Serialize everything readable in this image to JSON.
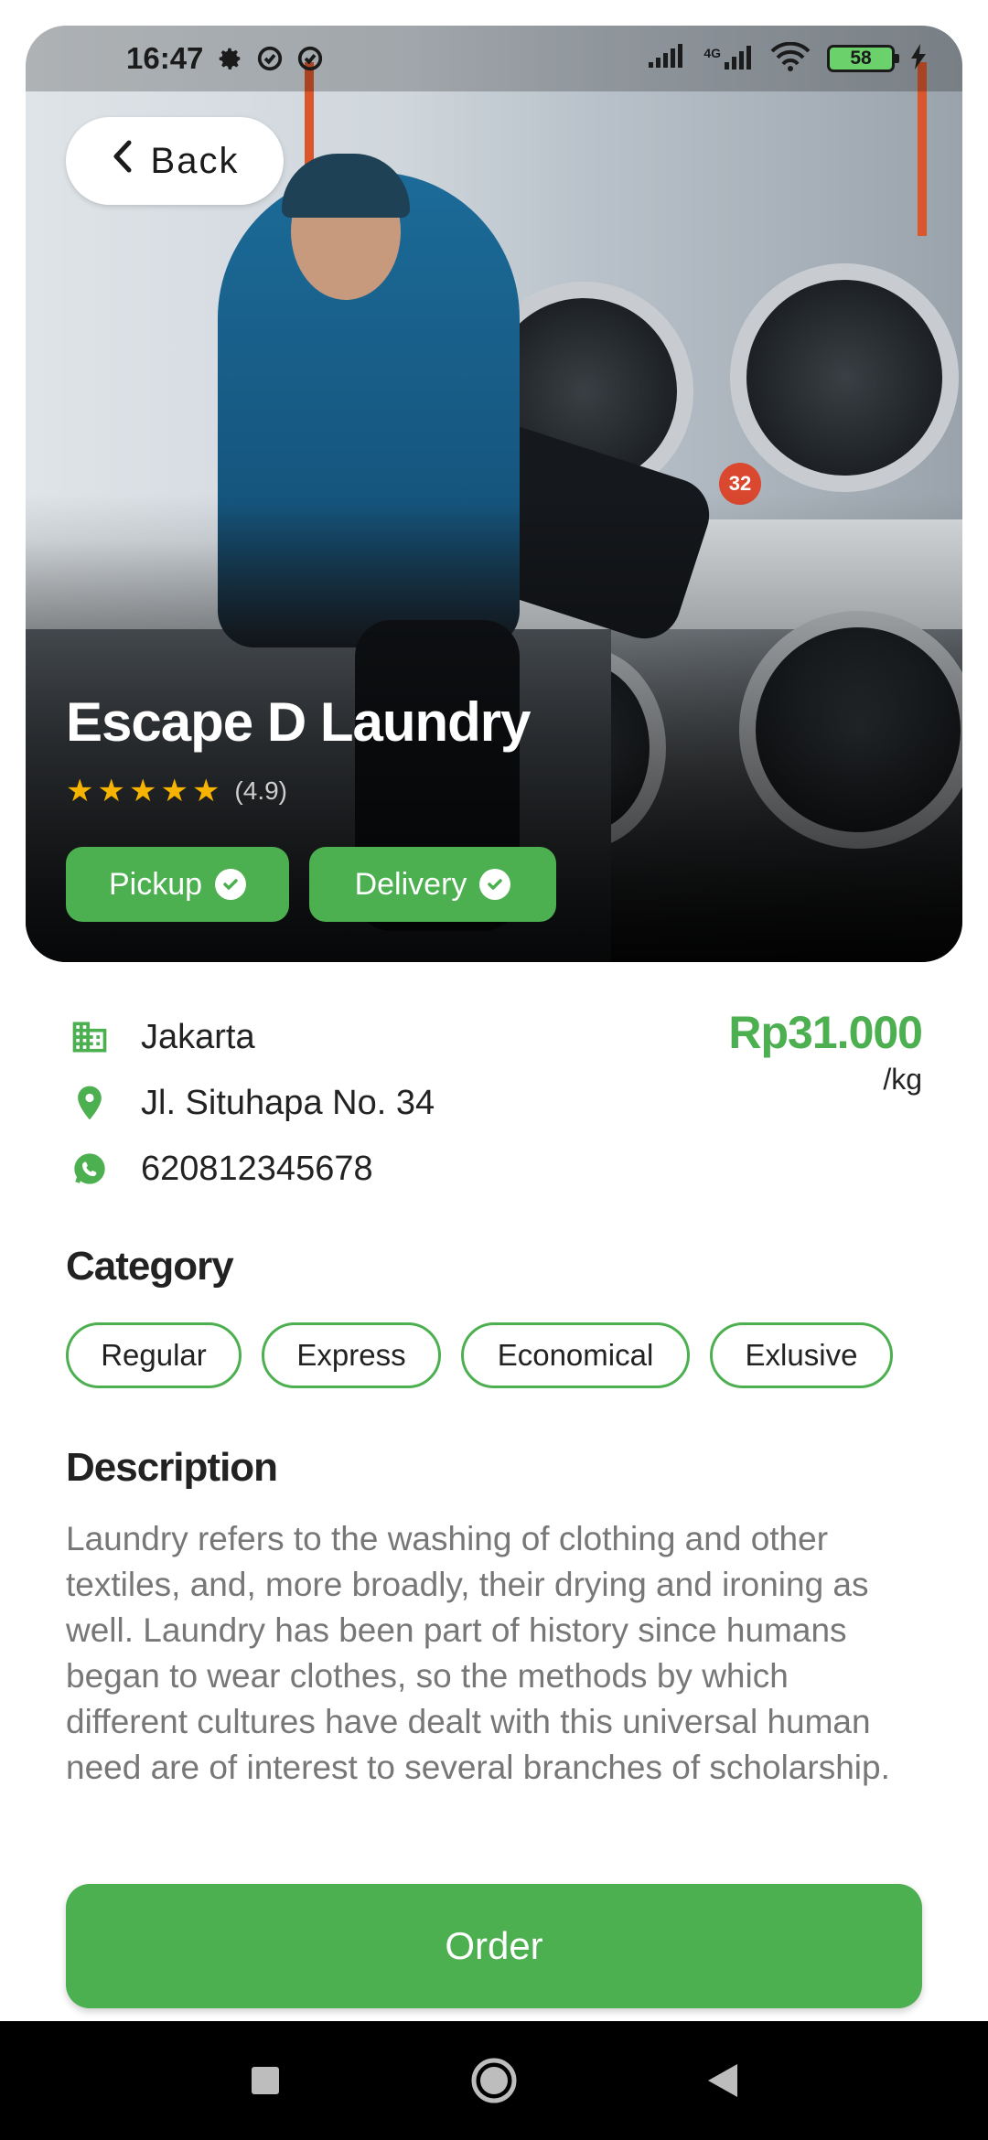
{
  "status_bar": {
    "time": "16:47",
    "network": "4G",
    "battery": "58"
  },
  "hero": {
    "back_label": "Back",
    "title": "Escape D Laundry",
    "stars": 5,
    "rating": "(4.9)",
    "photo_badge": "32",
    "features": [
      {
        "label": "Pickup"
      },
      {
        "label": "Delivery"
      }
    ]
  },
  "info": {
    "city": "Jakarta",
    "address": "Jl. Situhapa No. 34",
    "phone": "620812345678",
    "price": "Rp31.000",
    "unit": "/kg"
  },
  "category": {
    "title": "Category",
    "chips": [
      "Regular",
      "Express",
      "Economical",
      "Exlusive"
    ]
  },
  "description": {
    "title": "Description",
    "text": "Laundry refers to the washing of clothing and other textiles, and, more broadly, their drying and ironing as well. Laundry has been part of history since humans began to wear clothes, so the methods by which different cultures have dealt with this universal human need are of interest to several branches of scholarship."
  },
  "order_button": "Order",
  "colors": {
    "accent": "#4caf50",
    "star": "#f6b400"
  }
}
